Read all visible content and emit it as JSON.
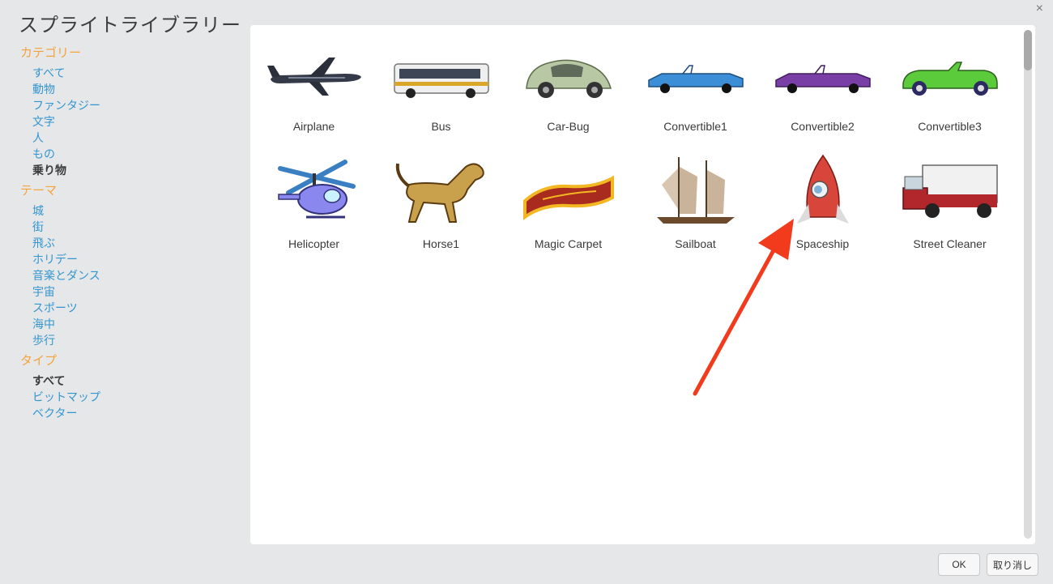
{
  "dialog": {
    "title": "スプライトライブラリー",
    "close_label": "×"
  },
  "sidebar": {
    "categories": {
      "heading": "カテゴリー",
      "items": [
        "すべて",
        "動物",
        "ファンタジー",
        "文字",
        "人",
        "もの",
        "乗り物"
      ]
    },
    "themes": {
      "heading": "テーマ",
      "items": [
        "城",
        "街",
        "飛ぶ",
        "ホリデー",
        "音楽とダンス",
        "宇宙",
        "スポーツ",
        "海中",
        "歩行"
      ]
    },
    "types": {
      "heading": "タイプ",
      "items": [
        "すべて",
        "ビットマップ",
        "ベクター"
      ]
    }
  },
  "sprites": [
    {
      "name": "Airplane",
      "icon": "airplane-icon"
    },
    {
      "name": "Bus",
      "icon": "bus-icon"
    },
    {
      "name": "Car-Bug",
      "icon": "car-bug-icon"
    },
    {
      "name": "Convertible1",
      "icon": "convertible-blue-icon"
    },
    {
      "name": "Convertible2",
      "icon": "convertible-purple-icon"
    },
    {
      "name": "Convertible3",
      "icon": "convertible-green-icon"
    },
    {
      "name": "Helicopter",
      "icon": "helicopter-icon"
    },
    {
      "name": "Horse1",
      "icon": "horse-icon"
    },
    {
      "name": "Magic Carpet",
      "icon": "magic-carpet-icon"
    },
    {
      "name": "Sailboat",
      "icon": "sailboat-icon"
    },
    {
      "name": "Spaceship",
      "icon": "spaceship-icon"
    },
    {
      "name": "Street Cleaner",
      "icon": "street-cleaner-icon"
    }
  ],
  "footer": {
    "ok_label": "OK",
    "cancel_label": "取り消し"
  },
  "colors": {
    "accent_orange": "#f5a33b",
    "link_blue": "#3396d1",
    "annotation_arrow": "#f23a1d"
  }
}
